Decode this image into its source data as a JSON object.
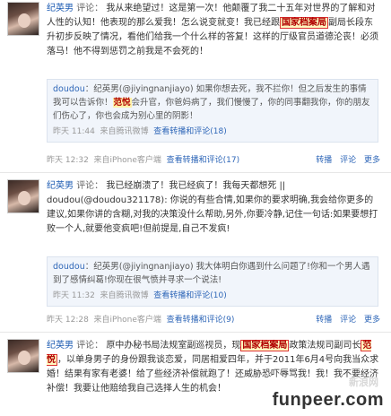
{
  "posts": [
    {
      "user": "纪英男",
      "comment_prefix": "评论：",
      "body": "我从来绝望过！这是第一次！他颠覆了我二十五年对世界的了解和对人性的认知！他表现的那么爱我！怎么说变就变！我已经跟",
      "highlight": "国家档案局",
      "body2": "副局长段东升初步反映了情况，看他们给我一个什么样的答复！这样的厅级官员道德沦丧！必须落马！他不得到惩罚之前我是不会死的！",
      "repost": {
        "user": "doudou",
        "text_a": "：纪英男(@jiyingnanjiayo) 如果你想去死，我不拦你！但之后发生的事情我可以告诉你！",
        "hl": "范悦",
        "text_b": "会升官，你爸妈病了，我们慢慢了，你的同事翻我你，你的朋友们伤心了，你也会成为别心里的阴影！",
        "time": "昨天 11:44",
        "source": "来自腾讯微博",
        "link": "查看转播和评论(18)"
      },
      "time": "昨天 12:32",
      "source": "来自iPhone客户端",
      "link": "查看转播和评论(17)",
      "actions": [
        "转播",
        "评论",
        "更多"
      ]
    },
    {
      "user": "纪英男",
      "comment_prefix": "评论：",
      "body": "我已经崩溃了！我已经疯了！我每天都想死 || ",
      "body2": "doudou(@doudou321178): 你说的有些合情,如果你的要求明确,我会给你更多的建议,如果你讲的含糊,对我的决策没什么帮助,另外,你要冷静,记住一句话:如果要想打败一个人,就要他变疯吧!但前提是,自己不发疯!",
      "repost": {
        "user": "doudou",
        "text_a": "：纪英男(@jiyingnanjiayo) 我大体明白你遇到什么问题了!你和一个男人遇到了感情纠葛!你现在很气愤并寻求一个说法!",
        "time": "昨天 11:32",
        "source": "来自腾讯微博",
        "link": "查看转播和评论(10)"
      },
      "time": "昨天 12:28",
      "source": "来自iPhone客户端",
      "link": "查看转播和评论(9)",
      "actions": [
        "转播",
        "评论",
        "更多"
      ]
    },
    {
      "user": "纪英男",
      "comment_prefix": "评论：",
      "body": "原中办秘书局法规室副巡视员，现",
      "highlight": "国家档案局",
      "body2": "政策法规司副司长",
      "hl2": "范悦",
      "body3": "，以单身男子的身份跟我谈恋爱，同居相爱四年，并于2011年6月4号向我当众求婚！结果有家有老婆！给了些经济补偿就跑了！还威胁恐吓辱骂我！我！我不要经济补偿！我要让他赔给我自己选择人生的机会！"
    }
  ],
  "watermark": "新浪网",
  "footer_logo": "funpeer.com"
}
